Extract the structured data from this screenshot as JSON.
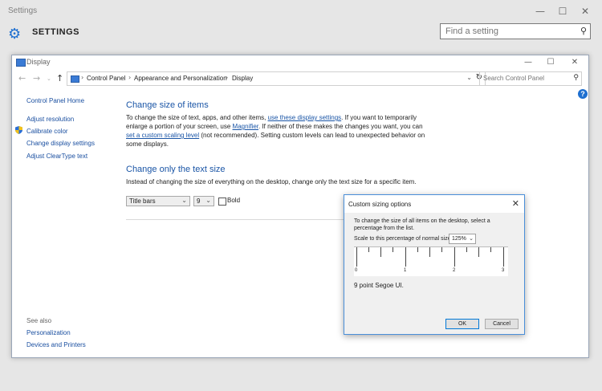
{
  "settings": {
    "window_title": "Settings",
    "heading": "SETTINGS",
    "search_placeholder": "Find a setting"
  },
  "control_panel": {
    "window_title": "Display",
    "breadcrumb": [
      "Control Panel",
      "Appearance and Personalization",
      "Display"
    ],
    "search_placeholder": "Search Control Panel",
    "sidebar": {
      "home": "Control Panel Home",
      "links": [
        "Adjust resolution",
        "Calibrate color",
        "Change display settings",
        "Adjust ClearType text"
      ],
      "see_also_label": "See also",
      "see_also": [
        "Personalization",
        "Devices and Printers"
      ]
    },
    "section1": {
      "heading": "Change size of items",
      "t1": "To change the size of text, apps, and other items, ",
      "link1": "use these display settings",
      "t2": ".  If you want to temporarily enlarge a portion of your screen, use ",
      "link2": "Magnifier",
      "t3": ".  If neither of these makes the changes you want, you can ",
      "link3": "set a custom scaling level",
      "t4": " (not recommended).  Setting custom levels can lead to unexpected behavior on some displays."
    },
    "section2": {
      "heading": "Change only the text size",
      "text": "Instead of changing the size of everything on the desktop, change only the text size for a specific item.",
      "item_value": "Title bars",
      "size_value": "9",
      "bold_label": "Bold"
    }
  },
  "dialog": {
    "title": "Custom sizing options",
    "description": "To change the size of all items on the desktop, select a percentage from the list.",
    "scale_label": "Scale to this percentage of normal size:",
    "scale_value": "125%",
    "ruler_labels": [
      "0",
      "1",
      "2",
      "3"
    ],
    "sample_text": "9 point Segoe UI.",
    "ok_label": "OK",
    "cancel_label": "Cancel"
  }
}
